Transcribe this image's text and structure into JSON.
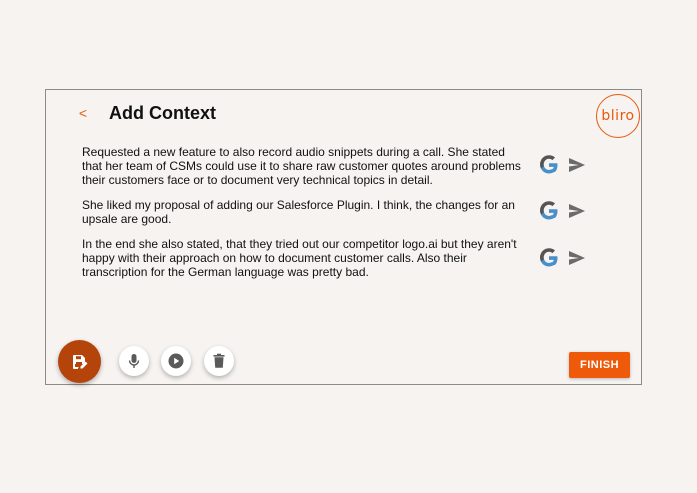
{
  "header": {
    "back_label": "<",
    "title": "Add Context"
  },
  "logo": {
    "text": "bliro",
    "color": "#e8590c"
  },
  "entries": [
    {
      "text": "Requested a new feature to also record audio snippets during a call. She stated that her team of CSMs could use it to share raw customer quotes around problems their customers face or to document very technical topics in detail.",
      "icons": [
        "google-icon",
        "send-icon"
      ]
    },
    {
      "text": "She liked my proposal of adding our Salesforce Plugin. I think, the changes for an upsale are good.",
      "icons": [
        "google-icon",
        "send-icon"
      ]
    },
    {
      "text": "In the end she also stated, that they tried out our competitor logo.ai but they aren't happy with their approach on how to document customer calls. Also their transcription for the German language was pretty bad.",
      "icons": [
        "google-icon",
        "send-icon"
      ]
    }
  ],
  "toolbar": {
    "save_icon": "save-edit-icon",
    "mic_icon": "microphone-icon",
    "play_icon": "play-icon",
    "delete_icon": "trash-icon"
  },
  "finish_button": {
    "label": "FINISH"
  },
  "colors": {
    "accent": "#ee5a0a",
    "fab": "#b4440a",
    "background": "#f6f3f0",
    "border": "#8b8b8b"
  }
}
